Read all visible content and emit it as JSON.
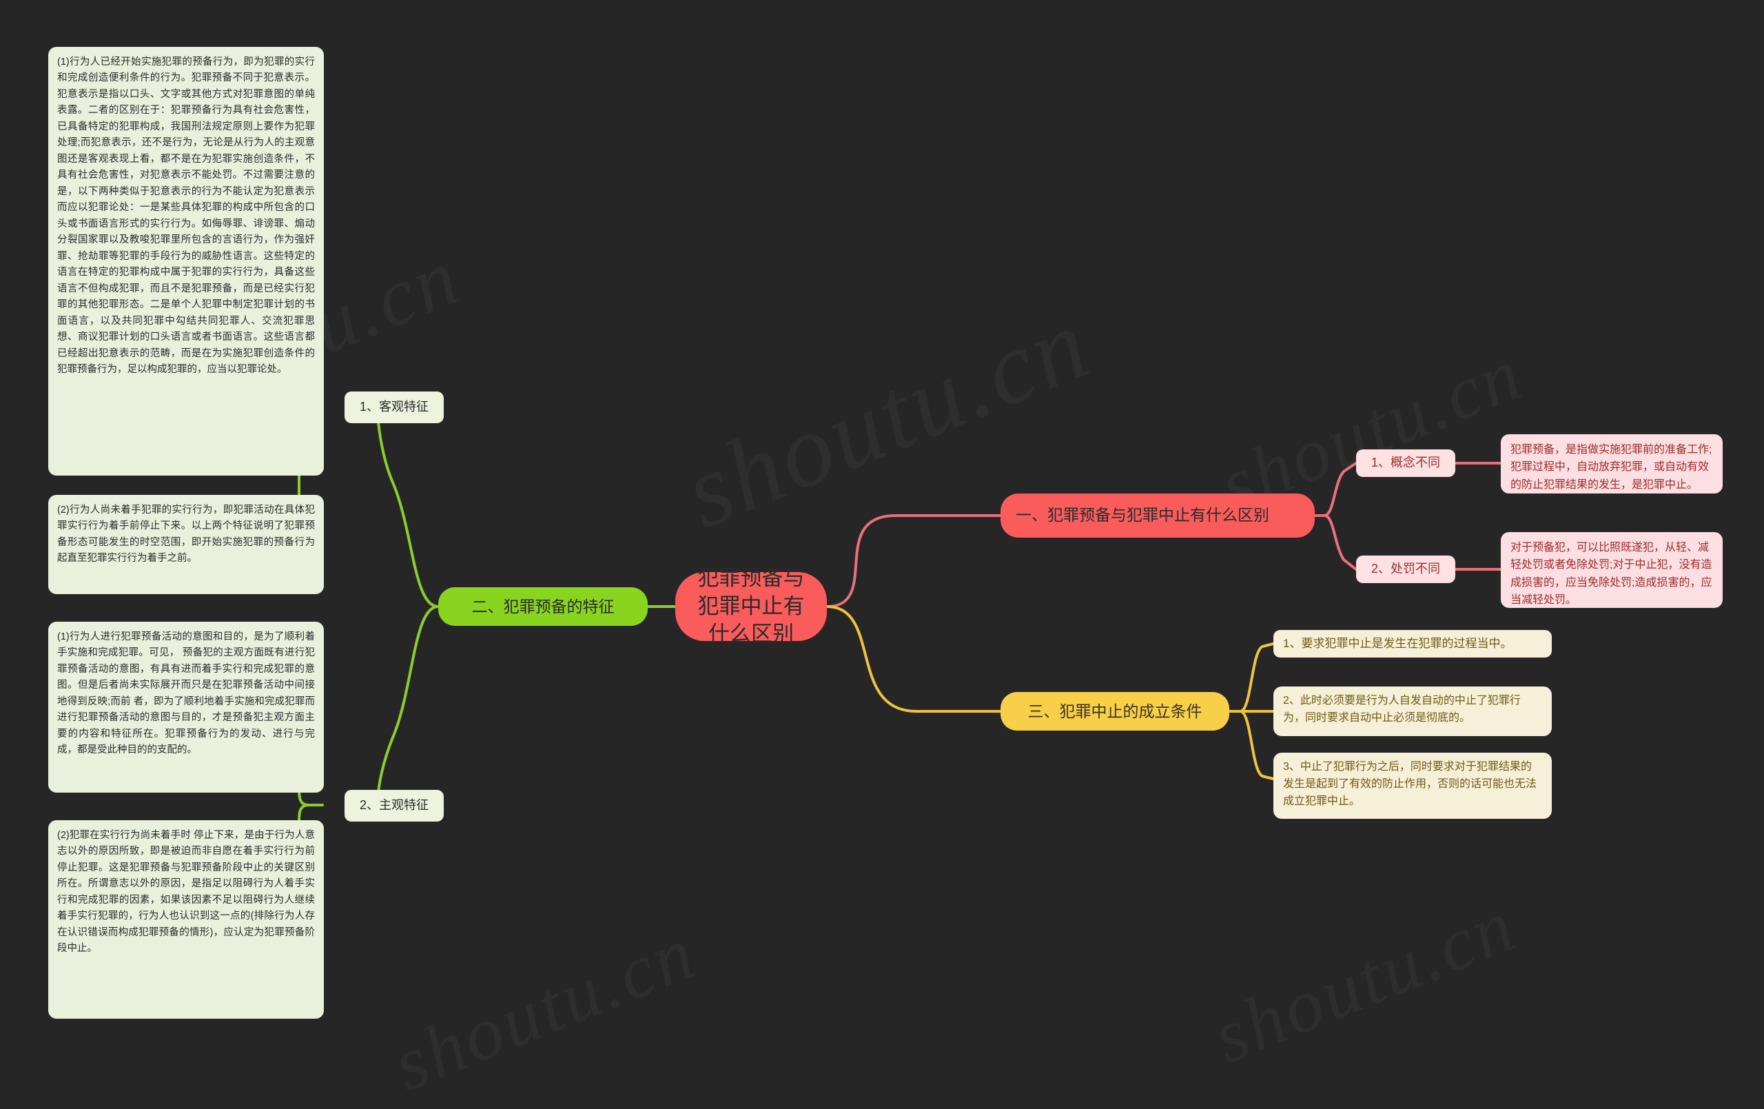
{
  "canvas": {
    "background": "#262626",
    "watermarks": [
      "shoutu.cn",
      "shoutu.cn",
      "shoutu.cn",
      "shoutu.cn",
      "shoutu.cn"
    ]
  },
  "colors": {
    "background": "#262626",
    "root_fill": "#fa5c5c",
    "red_branch": "#fa5c5c",
    "red_leaf_fill": "#fcdfe2",
    "red_leaf_text": "#9e2a2a",
    "green_branch": "#88d41f",
    "green_leaf_fill": "#e9f0dc",
    "green_edge": "#8ccc2e",
    "yellow_branch": "#f8cf49",
    "yellow_leaf_fill": "#f7f0d8",
    "yellow_leaf_text": "#6d5a14",
    "red_edge": "#e8707c"
  },
  "root": {
    "label": "犯罪预备与犯罪中止有什么区别"
  },
  "branches": {
    "one": {
      "label": "一、犯罪预备与犯罪中止有什么区别",
      "children": [
        {
          "label": "1、概念不同",
          "detail": "犯罪预备，是指做实施犯罪前的准备工作;犯罪过程中，自动放弃犯罪，或自动有效的防止犯罪结果的发生，是犯罪中止。"
        },
        {
          "label": "2、处罚不同",
          "detail": "对于预备犯，可以比照既遂犯，从轻、减轻处罚或者免除处罚;对于中止犯，没有造成损害的，应当免除处罚;造成损害的，应当减轻处罚。"
        }
      ]
    },
    "two": {
      "label": "二、犯罪预备的特征",
      "children": [
        {
          "label": "1、客观特征",
          "details": [
            "(1)行为人已经开始实施犯罪的预备行为，即为犯罪的实行和完成创造便利条件的行为。犯罪预备不同于犯意表示。犯意表示是指以口头、文字或其他方式对犯罪意图的单纯表露。二者的区别在于：犯罪预备行为具有社会危害性，已具备特定的犯罪构成，我国刑法规定原则上要作为犯罪处理;而犯意表示，还不是行为，无论是从行为人的主观意图还是客观表现上看，都不是在为犯罪实施创造条件，不具有社会危害性，对犯意表示不能处罚。不过需要注意的是，以下两种类似于犯意表示的行为不能认定为犯意表示而应以犯罪论处：一是某些具体犯罪的构成中所包含的口头或书面语言形式的实行行为。如侮辱罪、诽谤罪、煽动分裂国家罪以及教唆犯罪里所包含的言语行为，作为强奸罪、抢劫罪等犯罪的手段行为的威胁性语言。这些特定的语言在特定的犯罪构成中属于犯罪的实行行为，具备这些语言不但构成犯罪，而且不是犯罪预备，而是已经实行犯罪的其他犯罪形态。二是单个人犯罪中制定犯罪计划的书面语言，以及共同犯罪中勾结共同犯罪人、交流犯罪思想、商议犯罪计划的口头语言或者书面语言。这些语言都已经超出犯意表示的范畴，而是在为实施犯罪创造条件的犯罪预备行为，足以构成犯罪的，应当以犯罪论处。",
            "(2)行为人尚未着手犯罪的实行行为，即犯罪活动在具体犯罪实行行为着手前停止下来。以上两个特征说明了犯罪预备形态可能发生的时空范围，即开始实施犯罪的预备行为起直至犯罪实行行为着手之前。"
          ]
        },
        {
          "label": "2、主观特征",
          "details": [
            "(1)行为人进行犯罪预备活动的意图和目的，是为了顺利着手实施和完成犯罪。可见， 预备犯的主观方面既有进行犯罪预备活动的意图，有具有进而着手实行和完成犯罪的意图。但是后者尚未实际展开而只是在犯罪预备活动中间接地得到反映;而前 者，即为了顺利地着手实施和完成犯罪而进行犯罪预备活动的意图与目的，才是预备犯主观方面主要的内容和特征所在。犯罪预备行为的发动、进行与完成，都是受此种目的的支配的。",
            "(2)犯罪在实行行为尚未着手时 停止下来，是由于行为人意志以外的原因所致，即是被迫而非自愿在着手实行行为前停止犯罪。这是犯罪预备与犯罪预备阶段中止的关键区别所在。所谓意志以外的原因，是指足以阻碍行为人着手实行和完成犯罪的因素，如果该因素不足以阻碍行为人继续着手实行犯罪的，行为人也认识到这一点的(排除行为人存在认识错误而构成犯罪预备的情形)，应认定为犯罪预备阶段中止。"
          ]
        }
      ]
    },
    "three": {
      "label": "三、犯罪中止的成立条件",
      "children": [
        {
          "label": "1、要求犯罪中止是发生在犯罪的过程当中。"
        },
        {
          "label": "2、此时必须要是行为人自发自动的中止了犯罪行为，同时要求自动中止必须是彻底的。"
        },
        {
          "label": "3、中止了犯罪行为之后，同时要求对于犯罪结果的发生是起到了有效的防止作用，否则的话可能也无法成立犯罪中止。"
        }
      ]
    }
  }
}
